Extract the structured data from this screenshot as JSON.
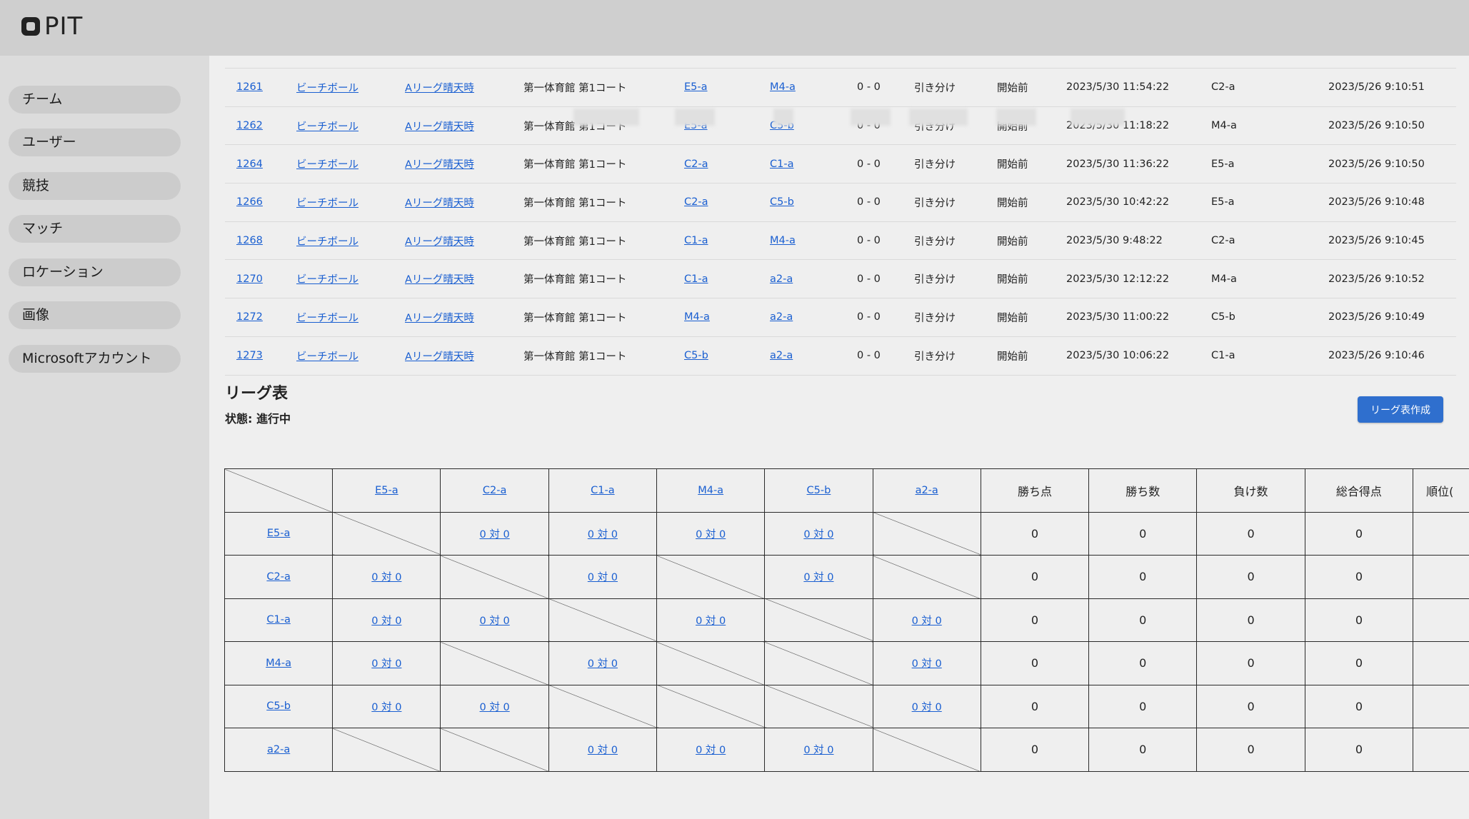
{
  "app": {
    "logo_text": "PIT"
  },
  "sidebar": {
    "items": [
      {
        "label": "チーム"
      },
      {
        "label": "ユーザー"
      },
      {
        "label": "競技"
      },
      {
        "label": "マッチ"
      },
      {
        "label": "ロケーション"
      },
      {
        "label": "画像"
      },
      {
        "label": "Microsoftアカウント"
      }
    ]
  },
  "matches": [
    {
      "id": "1261",
      "sport": "ビーチボール",
      "league": "Aリーグ晴天時",
      "venue": "第一体育館 第1コート",
      "team1": "E5-a",
      "team2": "M4-a",
      "score": "0 - 0",
      "result": "引き分け",
      "state": "開始前",
      "start": "2023/5/30 11:54:22",
      "referee": "C2-a",
      "updated": "2023/5/26 9:10:51"
    },
    {
      "id": "1262",
      "sport": "ビーチボール",
      "league": "Aリーグ晴天時",
      "venue": "第一体育館 第1コート",
      "team1": "E5-a",
      "team2": "C5-b",
      "score": "0 - 0",
      "result": "引き分け",
      "state": "開始前",
      "start": "2023/5/30 11:18:22",
      "referee": "M4-a",
      "updated": "2023/5/26 9:10:50"
    },
    {
      "id": "1264",
      "sport": "ビーチボール",
      "league": "Aリーグ晴天時",
      "venue": "第一体育館 第1コート",
      "team1": "C2-a",
      "team2": "C1-a",
      "score": "0 - 0",
      "result": "引き分け",
      "state": "開始前",
      "start": "2023/5/30 11:36:22",
      "referee": "E5-a",
      "updated": "2023/5/26 9:10:50"
    },
    {
      "id": "1266",
      "sport": "ビーチボール",
      "league": "Aリーグ晴天時",
      "venue": "第一体育館 第1コート",
      "team1": "C2-a",
      "team2": "C5-b",
      "score": "0 - 0",
      "result": "引き分け",
      "state": "開始前",
      "start": "2023/5/30 10:42:22",
      "referee": "E5-a",
      "updated": "2023/5/26 9:10:48"
    },
    {
      "id": "1268",
      "sport": "ビーチボール",
      "league": "Aリーグ晴天時",
      "venue": "第一体育館 第1コート",
      "team1": "C1-a",
      "team2": "M4-a",
      "score": "0 - 0",
      "result": "引き分け",
      "state": "開始前",
      "start": "2023/5/30 9:48:22",
      "referee": "C2-a",
      "updated": "2023/5/26 9:10:45"
    },
    {
      "id": "1270",
      "sport": "ビーチボール",
      "league": "Aリーグ晴天時",
      "venue": "第一体育館 第1コート",
      "team1": "C1-a",
      "team2": "a2-a",
      "score": "0 - 0",
      "result": "引き分け",
      "state": "開始前",
      "start": "2023/5/30 12:12:22",
      "referee": "M4-a",
      "updated": "2023/5/26 9:10:52"
    },
    {
      "id": "1272",
      "sport": "ビーチボール",
      "league": "Aリーグ晴天時",
      "venue": "第一体育館 第1コート",
      "team1": "M4-a",
      "team2": "a2-a",
      "score": "0 - 0",
      "result": "引き分け",
      "state": "開始前",
      "start": "2023/5/30 11:00:22",
      "referee": "C5-b",
      "updated": "2023/5/26 9:10:49"
    },
    {
      "id": "1273",
      "sport": "ビーチボール",
      "league": "Aリーグ晴天時",
      "venue": "第一体育館 第1コート",
      "team1": "C5-b",
      "team2": "a2-a",
      "score": "0 - 0",
      "result": "引き分け",
      "state": "開始前",
      "start": "2023/5/30 10:06:22",
      "referee": "C1-a",
      "updated": "2023/5/26 9:10:46"
    }
  ],
  "league": {
    "title": "リーグ表",
    "status": "状態: 進行中",
    "create_button": "リーグ表作成",
    "teams": [
      "E5-a",
      "C2-a",
      "C1-a",
      "M4-a",
      "C5-b",
      "a2-a"
    ],
    "stat_headers": [
      "勝ち点",
      "勝ち数",
      "負け数",
      "総合得点",
      "順位("
    ],
    "grid": [
      [
        "",
        "0 対 0",
        "0 対 0",
        "0 対 0",
        "0 対 0",
        ""
      ],
      [
        "0 対 0",
        "",
        "0 対 0",
        "",
        "0 対 0",
        ""
      ],
      [
        "0 対 0",
        "0 対 0",
        "",
        "0 対 0",
        "",
        "0 対 0"
      ],
      [
        "0 対 0",
        "",
        "0 対 0",
        "",
        "",
        "0 対 0"
      ],
      [
        "0 対 0",
        "0 対 0",
        "",
        "",
        "",
        "0 対 0"
      ],
      [
        "",
        "",
        "0 対 0",
        "0 対 0",
        "0 対 0",
        ""
      ]
    ],
    "stats": [
      [
        "0",
        "0",
        "0",
        "0",
        ""
      ],
      [
        "0",
        "0",
        "0",
        "0",
        ""
      ],
      [
        "0",
        "0",
        "0",
        "0",
        ""
      ],
      [
        "0",
        "0",
        "0",
        "0",
        ""
      ],
      [
        "0",
        "0",
        "0",
        "0",
        ""
      ],
      [
        "0",
        "0",
        "0",
        "0",
        ""
      ]
    ]
  }
}
